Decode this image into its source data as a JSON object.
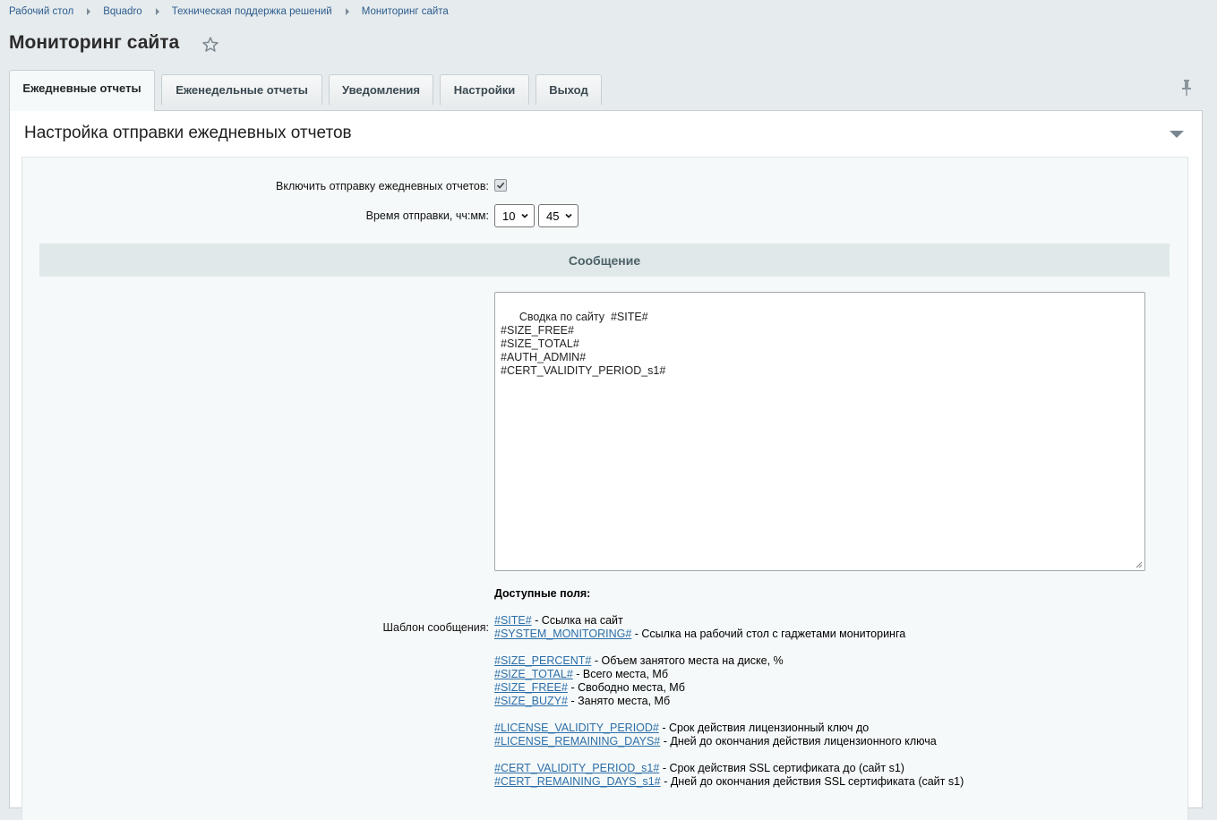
{
  "breadcrumbs": [
    "Рабочий стол",
    "Bquadro",
    "Техническая поддержка решений",
    "Мониторинг сайта"
  ],
  "page_title": "Мониторинг сайта",
  "tabs": [
    {
      "label": "Ежедневные отчеты",
      "active": true
    },
    {
      "label": "Еженедельные отчеты",
      "active": false
    },
    {
      "label": "Уведомления",
      "active": false
    },
    {
      "label": "Настройки",
      "active": false
    },
    {
      "label": "Выход",
      "active": false
    }
  ],
  "section": {
    "title": "Настройка отправки ежедневных отчетов",
    "enable_label": "Включить отправку ежедневных отчетов:",
    "enable_checked": true,
    "time_label": "Время отправки, чч:мм:",
    "hour": "10",
    "minute": "45",
    "message_header": "Сообщение",
    "template_label": "Шаблон сообщения:",
    "template_text": "Сводка по сайту  #SITE#\n#SIZE_FREE#\n#SIZE_TOTAL#\n#AUTH_ADMIN#\n#CERT_VALIDITY_PERIOD_s1#",
    "fields_title": "Доступные поля:",
    "field_groups": [
      [
        {
          "code": "#SITE#",
          "desc": " - Ссылка на сайт"
        },
        {
          "code": "#SYSTEM_MONITORING#",
          "desc": " - Ссылка на рабочий стол с гаджетами мониторинга"
        }
      ],
      [
        {
          "code": "#SIZE_PERCENT#",
          "desc": " - Объем занятого места на диске, %"
        },
        {
          "code": "#SIZE_TOTAL#",
          "desc": " - Всего места, Мб"
        },
        {
          "code": "#SIZE_FREE#",
          "desc": " - Свободно места, Мб"
        },
        {
          "code": "#SIZE_BUZY#",
          "desc": " - Занято места, Мб"
        }
      ],
      [
        {
          "code": "#LICENSE_VALIDITY_PERIOD#",
          "desc": " - Срок действия лицензионный ключ до"
        },
        {
          "code": "#LICENSE_REMAINING_DAYS#",
          "desc": " - Дней до окончания действия лицензионного ключа"
        }
      ],
      [
        {
          "code": "#CERT_VALIDITY_PERIOD_s1#",
          "desc": " - Срок действия SSL сертификата до (сайт s1)"
        },
        {
          "code": "#CERT_REMAINING_DAYS_s1#",
          "desc": " - Дней до окончания действия SSL сертификата (сайт s1)"
        }
      ]
    ]
  },
  "colors": {
    "link": "#2c6ea8",
    "background": "#e6ebee",
    "header_band": "#e0e8ea"
  }
}
